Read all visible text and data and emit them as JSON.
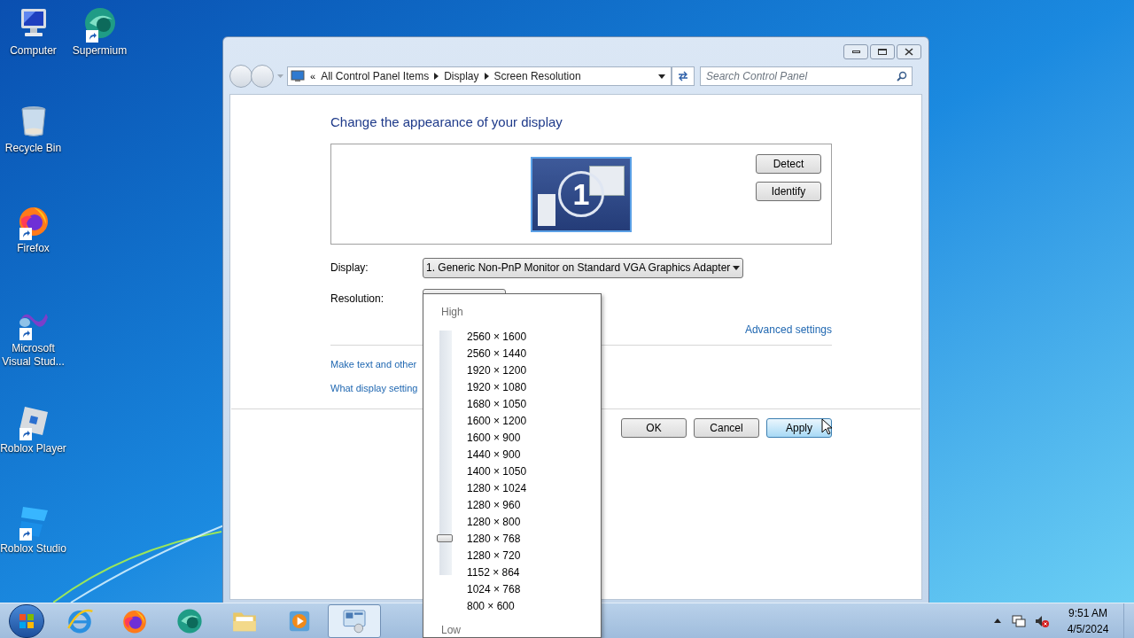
{
  "desktop_icons": [
    {
      "label": "Computer",
      "kind": "computer",
      "shortcut": false
    },
    {
      "label": "Supermium",
      "kind": "browser",
      "shortcut": true
    },
    {
      "label": "Recycle Bin",
      "kind": "bin",
      "shortcut": false
    },
    {
      "label": "Firefox",
      "kind": "firefox",
      "shortcut": true
    },
    {
      "label": "Microsoft Visual Stud...",
      "kind": "vs",
      "shortcut": true
    },
    {
      "label": "Roblox Player",
      "kind": "roblox",
      "shortcut": true
    },
    {
      "label": "Roblox Studio",
      "kind": "studio",
      "shortcut": true
    }
  ],
  "window": {
    "address_prefix": "«",
    "breadcrumbs": [
      "All Control Panel Items",
      "Display",
      "Screen Resolution"
    ],
    "search": {
      "placeholder": "Search Control Panel"
    },
    "heading": "Change the appearance of your display",
    "monitor_number": "1",
    "side_buttons": [
      "Detect",
      "Identify"
    ],
    "display": {
      "label": "Display:",
      "value": "1. Generic Non-PnP Monitor on Standard VGA Graphics Adapter"
    },
    "resolution": {
      "label": "Resolution:"
    },
    "advanced_link": "Advanced settings",
    "links": [
      "Make text and other",
      "What display setting"
    ],
    "buttons": [
      {
        "label": "OK",
        "hovered": false
      },
      {
        "label": "Cancel",
        "hovered": false
      },
      {
        "label": "Apply",
        "hovered": true
      }
    ]
  },
  "resolution_popup": {
    "high": "High",
    "low": "Low",
    "level": 0.125,
    "options": [
      "2560 × 1600",
      "2560 × 1440",
      "1920 × 1200",
      "1920 × 1080",
      "1680 × 1050",
      "1600 × 1200",
      "1600 × 900",
      "1440 × 900",
      "1400 × 1050",
      "1280 × 1024",
      "1280 × 960",
      "1280 × 800",
      "1280 × 768",
      "1280 × 720",
      "1152 × 864",
      "1024 × 768",
      "800 × 600"
    ]
  },
  "taskbar": {
    "items": [
      {
        "kind": "ie",
        "active": false
      },
      {
        "kind": "firefox",
        "active": false
      },
      {
        "kind": "browser",
        "active": false
      },
      {
        "kind": "folder",
        "active": false
      },
      {
        "kind": "media",
        "active": false
      },
      {
        "kind": "display",
        "active": true
      }
    ],
    "time": "9:51 AM",
    "date": "4/5/2024"
  }
}
